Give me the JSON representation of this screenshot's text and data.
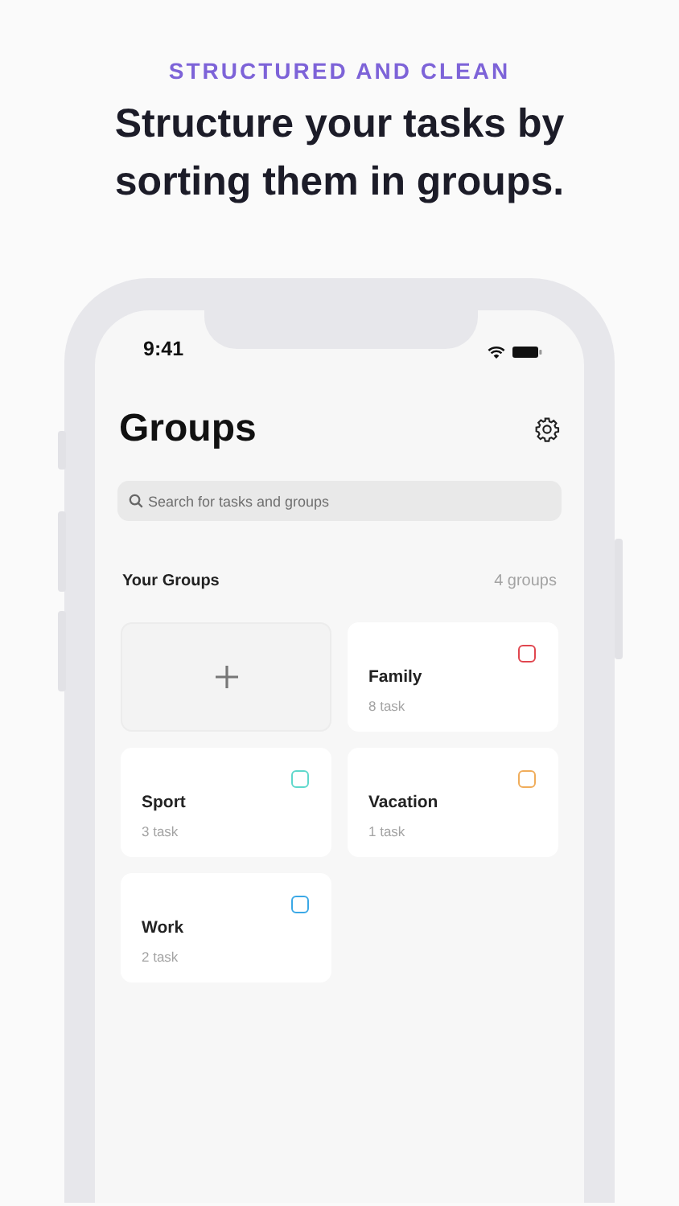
{
  "tagline": "STRUCTURED AND CLEAN",
  "headline": "Structure your tasks by sorting them in groups.",
  "status_bar": {
    "time": "9:41"
  },
  "screen": {
    "title": "Groups",
    "search": {
      "placeholder": "Search for tasks and groups"
    },
    "section_title": "Your Groups",
    "group_count": "4 groups",
    "groups": [
      {
        "kind": "add"
      },
      {
        "kind": "group",
        "name": "Family",
        "tasks": "8 task",
        "color": "#e0464f"
      },
      {
        "kind": "group",
        "name": "Sport",
        "tasks": "3 task",
        "color": "#5fd8cc"
      },
      {
        "kind": "group",
        "name": "Vacation",
        "tasks": "1 task",
        "color": "#f0ad5b"
      },
      {
        "kind": "group",
        "name": "Work",
        "tasks": "2 task",
        "color": "#3aa8e6"
      }
    ]
  }
}
